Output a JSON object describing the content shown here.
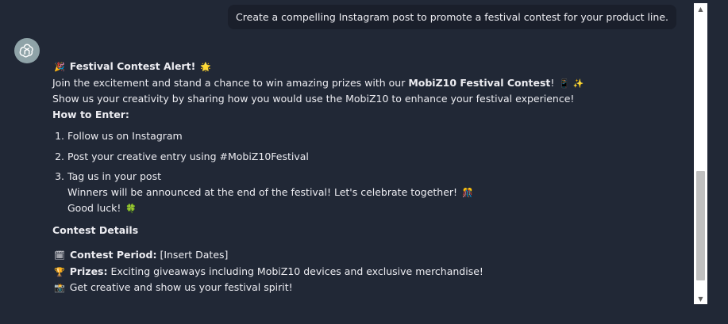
{
  "user_message": "Create a compelling Instagram post to promote a festival contest for your product line.",
  "assistant": {
    "heading_emoji_left": "🎉",
    "heading": "Festival Contest Alert!",
    "heading_emoji_right": "🌟",
    "intro_prefix": "Join the excitement and stand a chance to win amazing prizes with our ",
    "intro_bold": "MobiZ10 Festival Contest",
    "intro_suffix": "!",
    "intro_emojis": "📱 ✨",
    "line2": "Show us your creativity by sharing how you would use the MobiZ10 to enhance your festival experience!",
    "how_to_enter": "How to Enter:",
    "steps": [
      "Follow us on Instagram",
      "Post your creative entry using #MobiZ10Festival",
      "Tag us in your post"
    ],
    "winners_line": "Winners will be announced at the end of the festival! Let's celebrate together!",
    "winners_emoji": "🎊",
    "good_luck": "Good luck!",
    "good_luck_emoji": "🍀",
    "contest_details": "Contest Details",
    "details": [
      {
        "icon": "🗓",
        "label": "Contest Period:",
        "text": " [Insert Dates]"
      },
      {
        "icon": "🏆",
        "label": "Prizes:",
        "text": " Exciting giveaways including MobiZ10 devices and exclusive merchandise!"
      },
      {
        "icon": "📸",
        "label": "",
        "text": "Get creative and show us your festival spirit!"
      }
    ]
  },
  "scrollbar": {
    "up": "▲",
    "down": "▼"
  }
}
